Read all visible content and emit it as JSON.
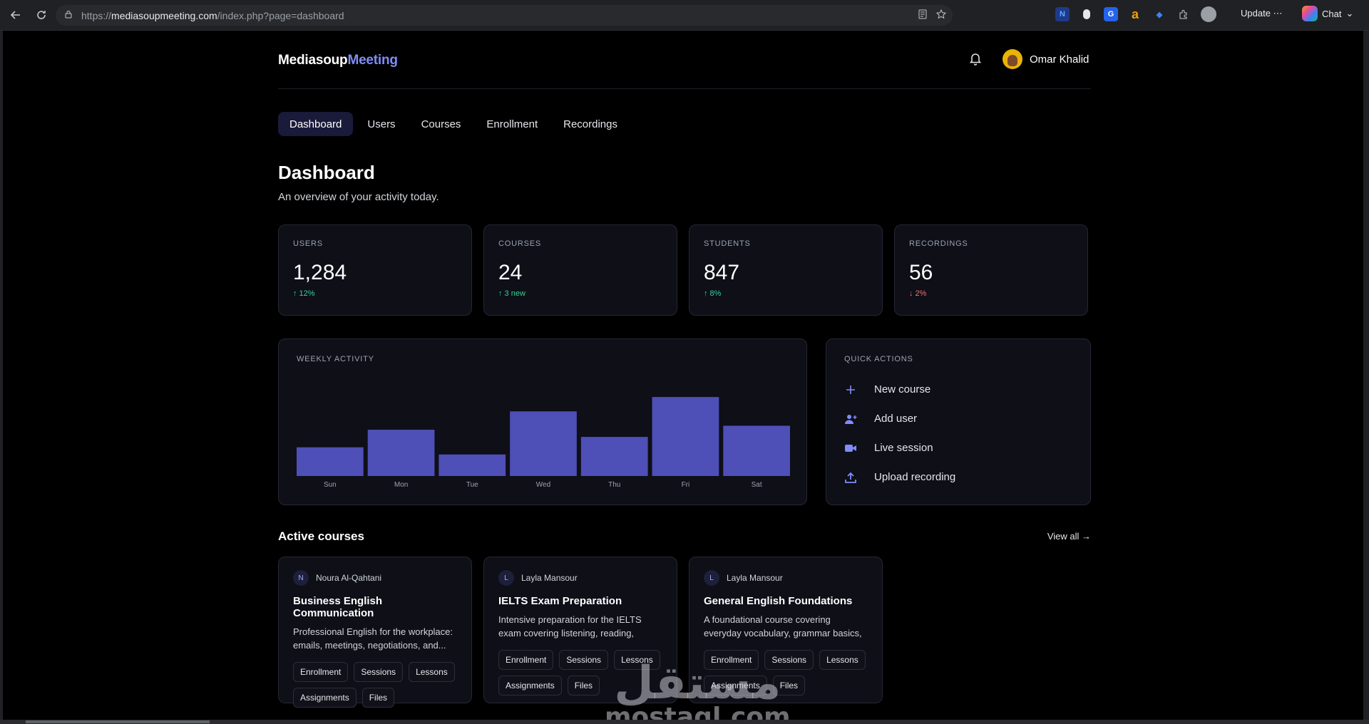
{
  "browser": {
    "url_prefix": "https://",
    "url_host": "mediasoupmeeting.com",
    "url_path": "/index.php?page=dashboard",
    "update_label": "Update",
    "chat_label": "Chat"
  },
  "app": {
    "logo_main": "Mediasoup",
    "logo_accent": "Meeting",
    "user_name": "Omar Khalid"
  },
  "tabs": [
    {
      "label": "Dashboard",
      "active": true
    },
    {
      "label": "Users"
    },
    {
      "label": "Courses"
    },
    {
      "label": "Enrollment"
    },
    {
      "label": "Recordings"
    }
  ],
  "header": {
    "title": "Dashboard",
    "subtitle": "An overview of your activity today."
  },
  "stats": [
    {
      "label": "USERS",
      "value": "1,284",
      "delta": "↑ 12%",
      "trend": "up"
    },
    {
      "label": "COURSES",
      "value": "24",
      "delta": "↑ 3 new",
      "trend": "up"
    },
    {
      "label": "STUDENTS",
      "value": "847",
      "delta": "↑ 8%",
      "trend": "up"
    },
    {
      "label": "RECORDINGS",
      "value": "56",
      "delta": "↓ 2%",
      "trend": "down"
    }
  ],
  "activity": {
    "title": "WEEKLY ACTIVITY"
  },
  "chart_data": {
    "type": "bar",
    "categories": [
      "Sun",
      "Mon",
      "Tue",
      "Wed",
      "Thu",
      "Fri",
      "Sat"
    ],
    "values": [
      36,
      58,
      27,
      81,
      49,
      99,
      63
    ],
    "ylim": [
      0,
      100
    ],
    "grid": false,
    "color": "#4f4fb8"
  },
  "quick_actions": {
    "title": "QUICK ACTIONS",
    "items": [
      {
        "label": "New course",
        "icon": "plus-icon"
      },
      {
        "label": "Add user",
        "icon": "user-plus-icon"
      },
      {
        "label": "Live session",
        "icon": "video-camera-icon"
      },
      {
        "label": "Upload recording",
        "icon": "upload-icon"
      }
    ]
  },
  "active_courses": {
    "title": "Active courses",
    "view_all": "View all →",
    "items": [
      {
        "initial": "N",
        "instructor": "Noura Al-Qahtani",
        "title": "Business English Communication",
        "desc": "Professional English for the workplace: emails, meetings, negotiations, and...",
        "chips": [
          "Enrollment",
          "Sessions",
          "Lessons",
          "Assignments",
          "Files"
        ]
      },
      {
        "initial": "L",
        "instructor": "Layla Mansour",
        "title": "IELTS Exam Preparation",
        "desc": "Intensive preparation for the IELTS exam covering listening, reading, writing, and...",
        "chips": [
          "Enrollment",
          "Sessions",
          "Lessons",
          "Assignments",
          "Files"
        ]
      },
      {
        "initial": "L",
        "instructor": "Layla Mansour",
        "title": "General English Foundations",
        "desc": "A foundational course covering everyday vocabulary, grammar basics, and...",
        "chips": [
          "Enrollment",
          "Sessions",
          "Lessons",
          "Assignments",
          "Files"
        ]
      }
    ]
  },
  "watermark": {
    "arabic": "مستقل",
    "latin": "mostaql.com"
  }
}
